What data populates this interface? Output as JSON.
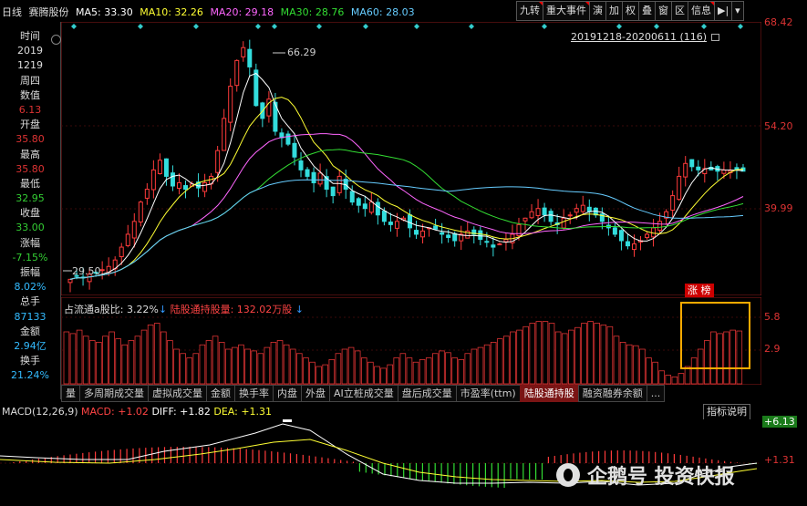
{
  "header": {
    "period": "日线",
    "stock_name": "赛腾股份",
    "ma": [
      {
        "label": "MA5: 33.30",
        "color": "#ffffff"
      },
      {
        "label": "MA10: 32.26",
        "color": "#ffff33"
      },
      {
        "label": "MA20: 29.18",
        "color": "#ff66ff"
      },
      {
        "label": "MA30: 28.76",
        "color": "#33dd33"
      },
      {
        "label": "MA60: 28.03",
        "color": "#66ccff"
      }
    ]
  },
  "toolbar": [
    "九转",
    "重大事件",
    "演",
    "加",
    "权",
    "叠",
    "窗",
    "区",
    "信息",
    "▶|",
    "▾"
  ],
  "date_range": "20191218-20200611 (116)",
  "info_panel": [
    {
      "label": "时间",
      "value_lines": [
        "2019",
        "1219",
        "周四"
      ]
    },
    {
      "label": "数值",
      "value": "6.13",
      "color": "#dd3333"
    },
    {
      "label": "开盘",
      "value": "35.80",
      "color": "#dd3333"
    },
    {
      "label": "最高",
      "value": "35.80",
      "color": "#dd3333"
    },
    {
      "label": "最低",
      "value": "32.95",
      "color": "#33cc33"
    },
    {
      "label": "收盘",
      "value": "33.00",
      "color": "#33cc33"
    },
    {
      "label": "涨幅",
      "value": "-7.15%",
      "color": "#33cc33"
    },
    {
      "label": "振幅",
      "value": "8.02%",
      "color": "#33bbff"
    },
    {
      "label": "总手",
      "value": "87133",
      "color": "#33bbff"
    },
    {
      "label": "金额",
      "value": "2.94亿",
      "color": "#33bbff"
    },
    {
      "label": "换手",
      "value": "21.24%",
      "color": "#33bbff"
    }
  ],
  "price_axis": [
    "68.42",
    "54.20",
    "39.99"
  ],
  "annotations": {
    "high": "66.29",
    "low": "29.50"
  },
  "indicator": {
    "ratio_label": "占流通a股比: 3.22%",
    "holding_label": "陆股通持股量: 132.02万股",
    "axis": [
      "5.8",
      "2.9"
    ],
    "tag": "涨 榜"
  },
  "tabs": [
    "量",
    "多周期成交量",
    "虚拟成交量",
    "金额",
    "换手率",
    "内盘",
    "外盘",
    "AI立桩成交量",
    "盘后成交量",
    "市盈率(ttm)",
    "陆股通持股",
    "融资融券余额",
    "..."
  ],
  "active_tab": "陆股通持股",
  "macd": {
    "title": "MACD(12,26,9)",
    "macd": "MACD: +1.02",
    "diff": "DIFF: +1.82",
    "dea": "DEA: +1.31",
    "axis_top": "+6.13",
    "axis_mid": "+1.31",
    "note": "指标说明"
  },
  "watermark": "企鹅号 投资快报"
}
